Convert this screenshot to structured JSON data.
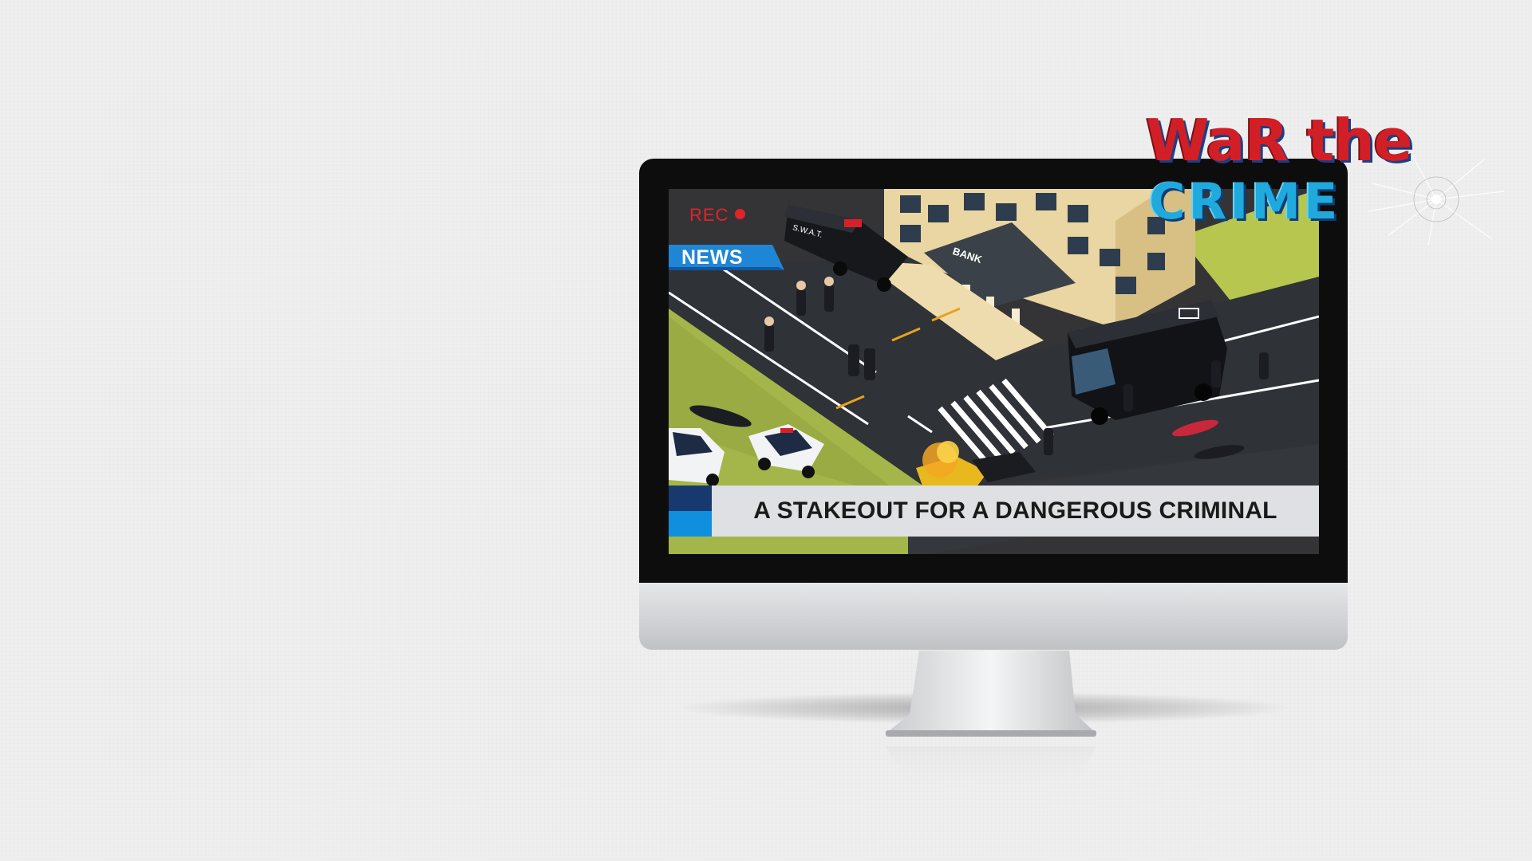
{
  "logo": {
    "line1": "WaR the",
    "line2": "CRIME"
  },
  "screen": {
    "rec_label": "REC",
    "news_label": "NEWS",
    "headline": "A STAKEOUT FOR A DANGEROUS CRIMINAL",
    "van_label": "S.W.A.T.",
    "bank_label": "BANK"
  },
  "colors": {
    "rec_red": "#e0242a",
    "news_blue": "#1f86d6",
    "ticker_dark": "#18396e",
    "ticker_light": "#0f8fde",
    "logo_red": "#d21f26",
    "logo_cyan": "#20a9dc"
  },
  "icons": [
    "recording-dot-icon",
    "cracked-glass-icon"
  ]
}
